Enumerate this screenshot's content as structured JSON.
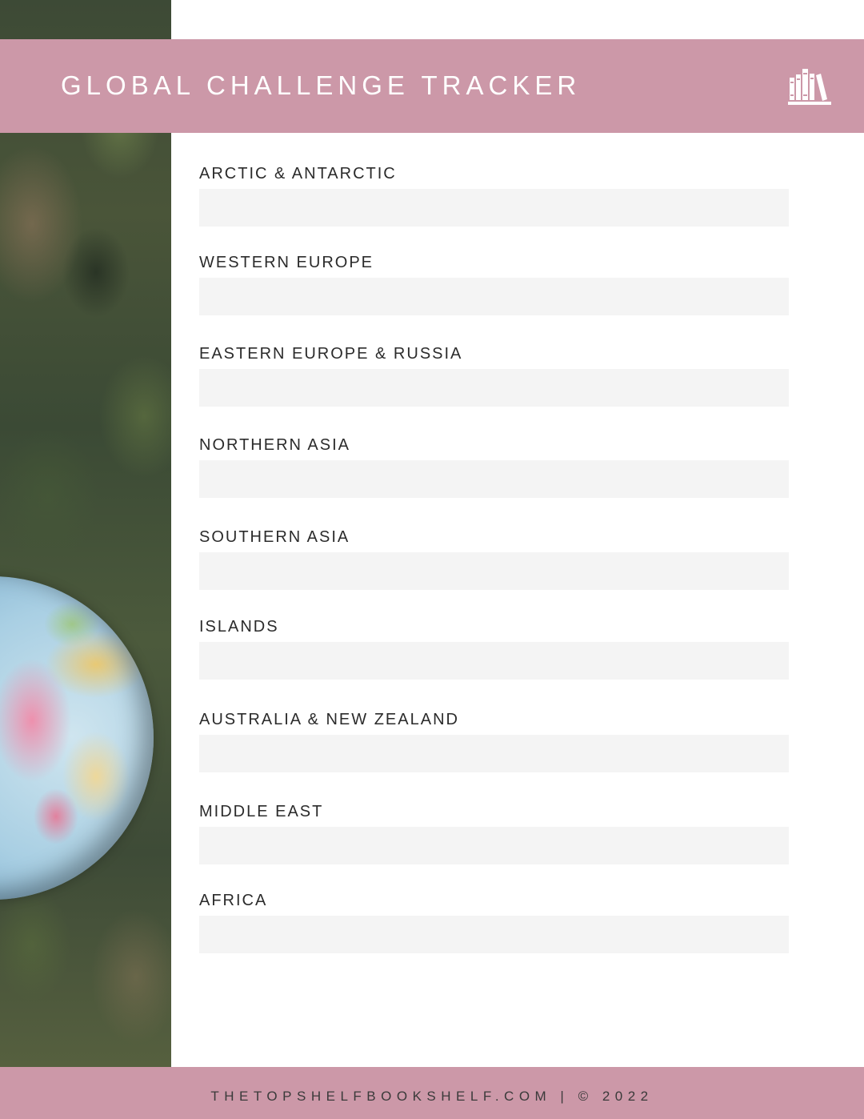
{
  "header": {
    "title": "GLOBAL CHALLENGE TRACKER",
    "icon": "bookshelf-icon"
  },
  "regions": [
    {
      "label": "ARCTIC & ANTARCTIC"
    },
    {
      "label": "WESTERN EUROPE"
    },
    {
      "label": "EASTERN EUROPE & RUSSIA"
    },
    {
      "label": "NORTHERN ASIA"
    },
    {
      "label": "SOUTHERN ASIA"
    },
    {
      "label": "ISLANDS"
    },
    {
      "label": "AUSTRALIA & NEW ZEALAND"
    },
    {
      "label": "MIDDLE EAST"
    },
    {
      "label": "AFRICA"
    }
  ],
  "footer": {
    "text": "THETOPSHELFBOOKSHELF.COM | © 2022"
  },
  "colors": {
    "accent": "#cc98a8",
    "field": "#f4f4f4",
    "text": "#2b2b2b"
  }
}
